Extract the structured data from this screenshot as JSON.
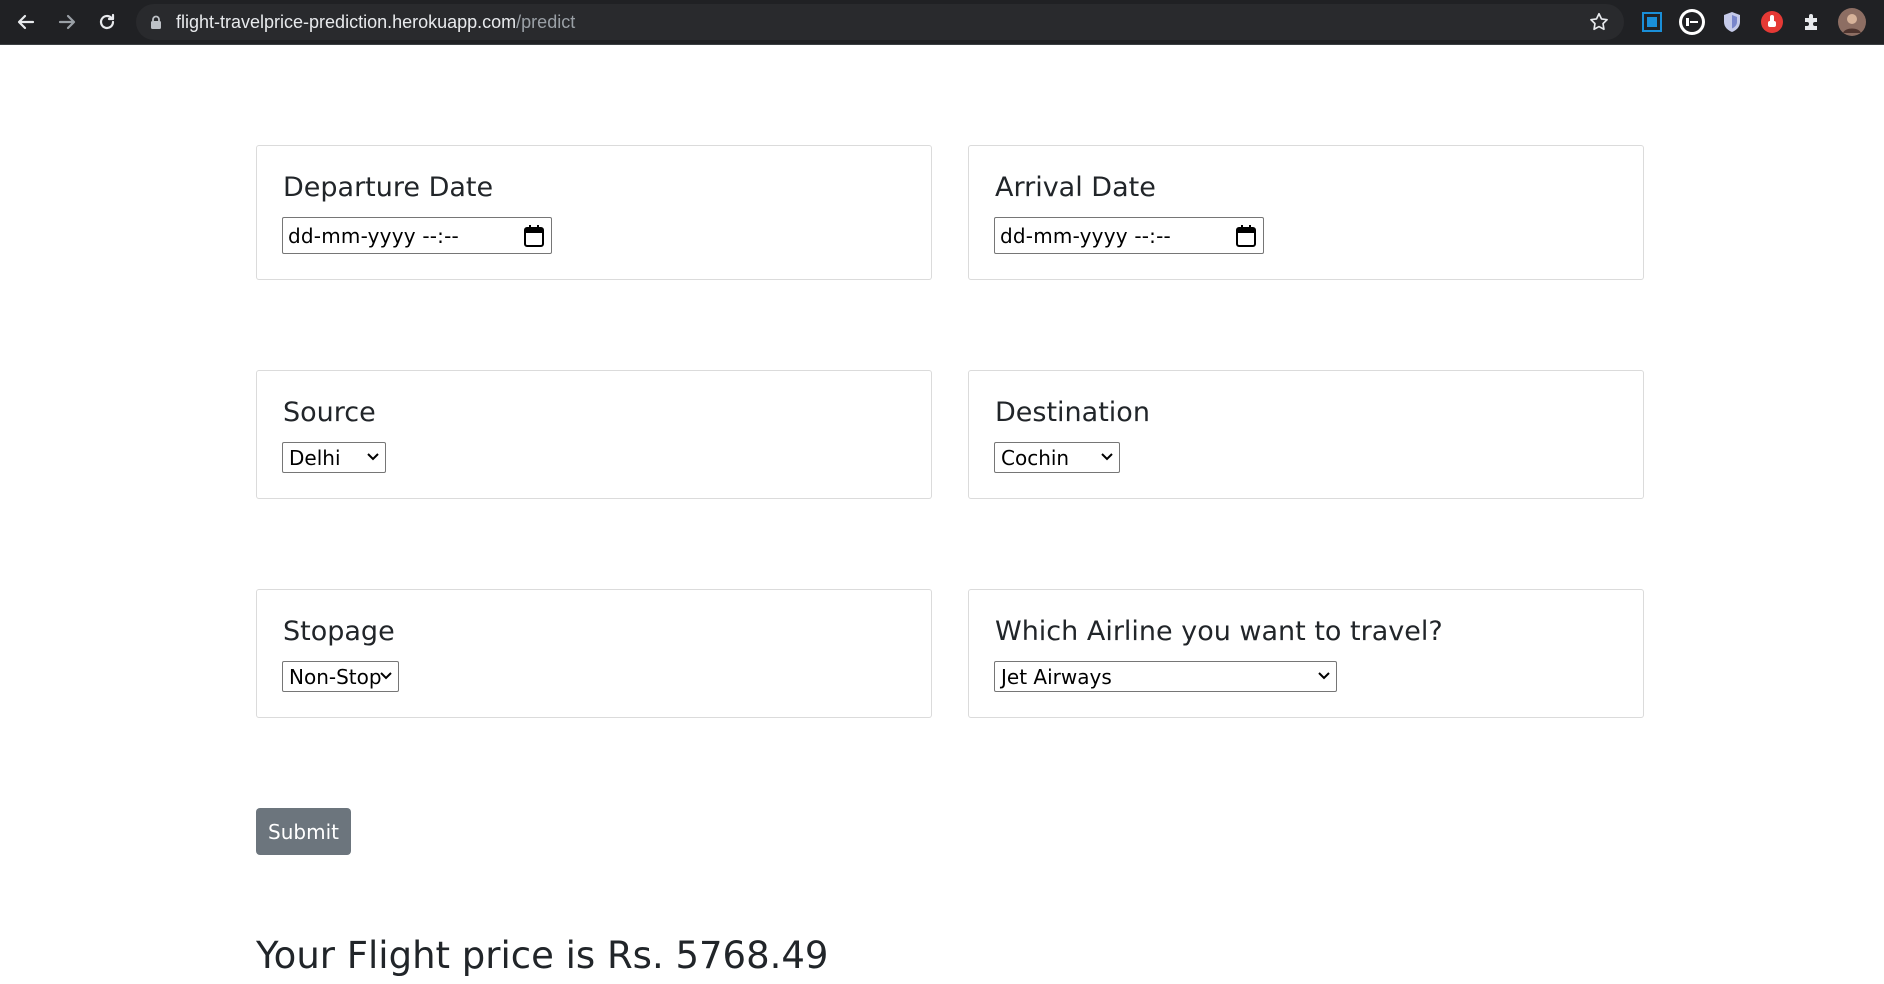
{
  "browser": {
    "url_host": "flight-travelprice-prediction.herokuapp.com",
    "url_path": "/predict",
    "back_icon": "arrow-left-icon",
    "forward_icon": "arrow-right-icon",
    "reload_icon": "reload-icon",
    "lock_icon": "lock-icon",
    "bookmark_icon": "star-icon",
    "extensions": [
      "screenshot-extension-icon",
      "dictionary-extension-icon",
      "shield-extension-icon",
      "red-hand-extension-icon",
      "puzzle-icon",
      "profile-avatar"
    ]
  },
  "form": {
    "departure": {
      "label": "Departure Date",
      "placeholder": "dd-mm-yyyy --:--"
    },
    "arrival": {
      "label": "Arrival Date",
      "placeholder": "dd-mm-yyyy --:--"
    },
    "source": {
      "label": "Source",
      "value": "Delhi"
    },
    "destination": {
      "label": "Destination",
      "value": "Cochin"
    },
    "stopage": {
      "label": "Stopage",
      "value": "Non-Stop"
    },
    "airline": {
      "label": "Which Airline you want to travel?",
      "value": "Jet Airways"
    },
    "submit_label": "Submit"
  },
  "result": {
    "text": "Your Flight price is Rs. 5768.49"
  },
  "colors": {
    "chrome": "#202124",
    "omnibox": "#292a2d",
    "button": "#6c757d",
    "text": "#212529"
  }
}
